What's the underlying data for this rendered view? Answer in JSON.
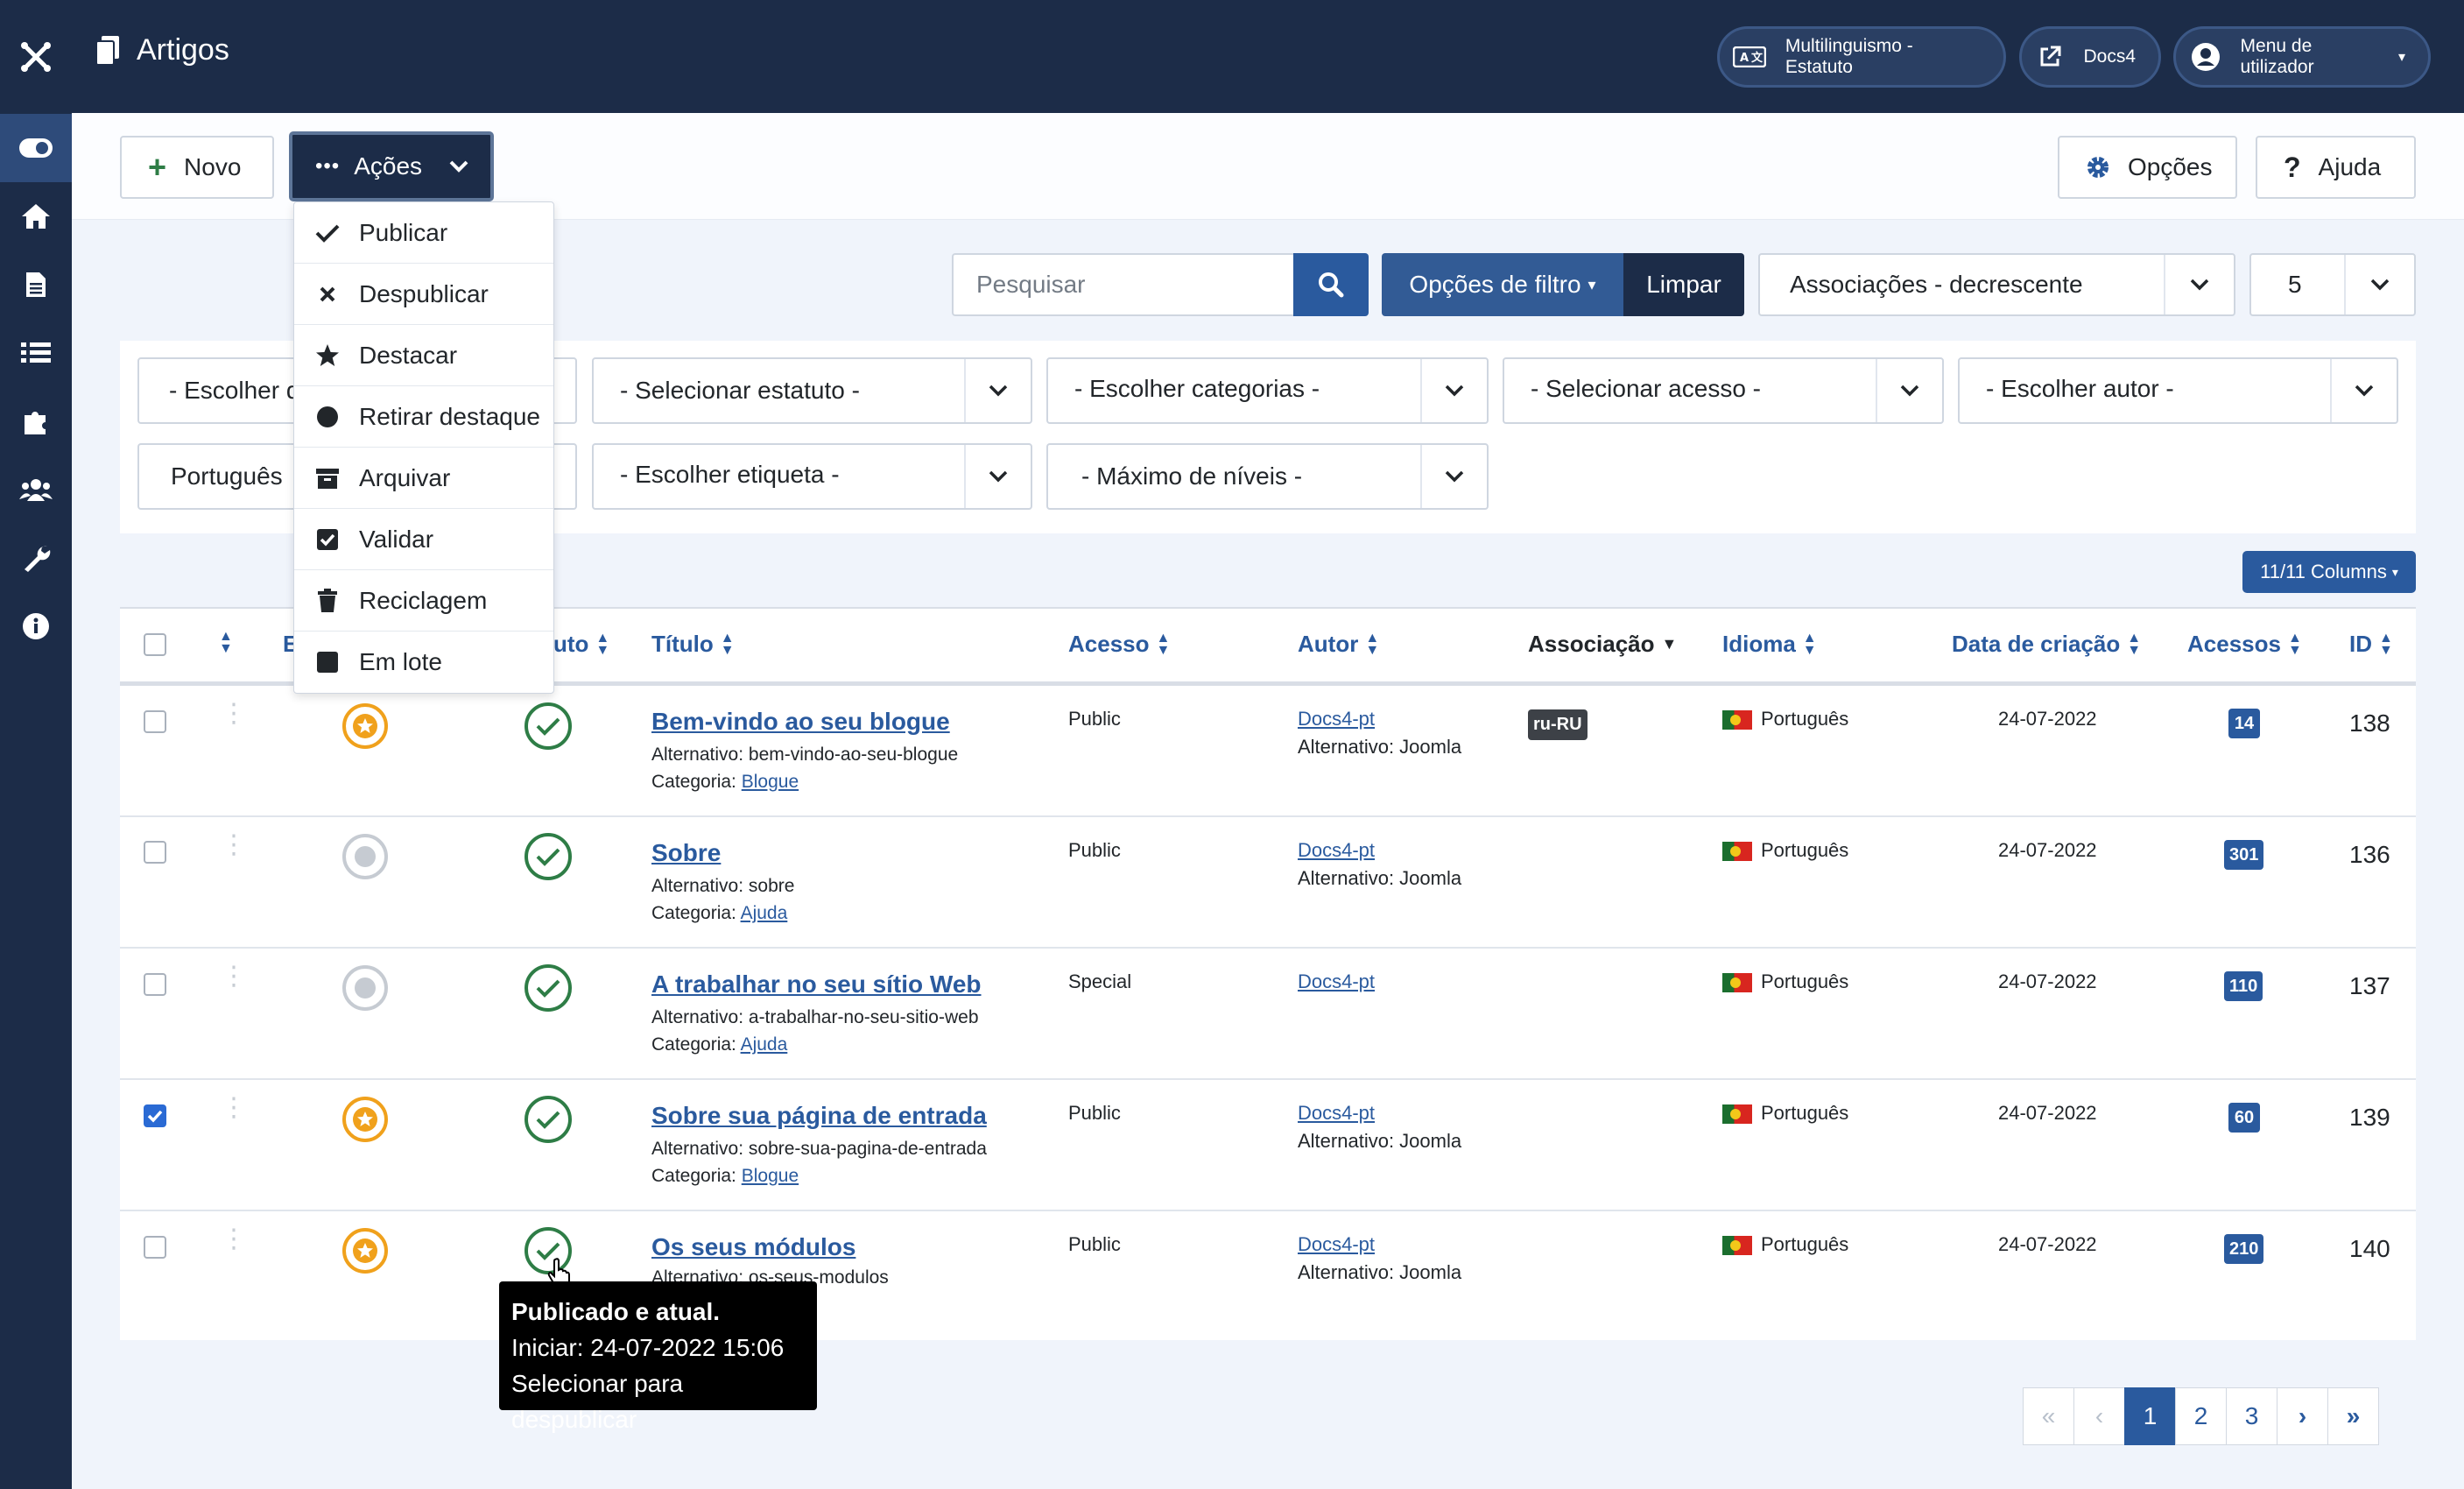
{
  "header": {
    "title": "Artigos",
    "buttons": [
      {
        "label": "Multilinguismo - Estatuto",
        "icon": "language-icon"
      },
      {
        "label": "Docs4",
        "icon": "external-link-icon"
      },
      {
        "label": "Menu de utilizador",
        "icon": "user-icon"
      }
    ]
  },
  "sidebar": {
    "items": [
      "toggle-icon",
      "home-icon",
      "article-icon",
      "list-icon",
      "puzzle-icon",
      "users-icon",
      "wrench-icon",
      "info-icon"
    ]
  },
  "toolbar": {
    "new_label": "Novo",
    "actions_label": "Ações",
    "options_label": "Opções",
    "help_label": "Ajuda"
  },
  "actions_menu": {
    "items": [
      {
        "label": "Publicar",
        "icon": "check-icon"
      },
      {
        "label": "Despublicar",
        "icon": "x-icon"
      },
      {
        "label": "Destacar",
        "icon": "star-icon"
      },
      {
        "label": "Retirar destaque",
        "icon": "circle-icon"
      },
      {
        "label": "Arquivar",
        "icon": "archive-icon"
      },
      {
        "label": "Validar",
        "icon": "checkbox-icon"
      },
      {
        "label": "Reciclagem",
        "icon": "trash-icon"
      },
      {
        "label": "Em lote",
        "icon": "square-icon"
      }
    ]
  },
  "search": {
    "placeholder": "Pesquisar",
    "filter_options_label": "Opções de filtro",
    "clear_label": "Limpar",
    "ordering": "Associações - decrescente",
    "limit": "5"
  },
  "filters": {
    "choose_site": "- Escolher d",
    "status": "- Selecionar estatuto -",
    "categories": "- Escolher categorias -",
    "access": "- Selecionar acesso -",
    "author": "- Escolher autor -",
    "language": "Português",
    "tag": "- Escolher etiqueta -",
    "levels": "- Máximo de níveis -"
  },
  "columns_label": "11/11 Columns",
  "table": {
    "headers": {
      "featured": "E",
      "status": "uto",
      "title": "Título",
      "access": "Acesso",
      "author": "Autor",
      "association": "Associação",
      "language": "Idioma",
      "date": "Data de criação",
      "hits": "Acessos",
      "id": "ID"
    },
    "rows": [
      {
        "checked": false,
        "featured": true,
        "title": "Bem-vindo ao seu blogue",
        "alias": "Alternativo: bem-vindo-ao-seu-blogue",
        "category_prefix": "Categoria:",
        "category": "Blogue",
        "access": "Public",
        "author": "Docs4-pt",
        "author_alias": "Alternativo: Joomla",
        "association": "ru-RU",
        "language": "Português",
        "date": "24-07-2022",
        "hits": "14",
        "id": "138"
      },
      {
        "checked": false,
        "featured": false,
        "title": "Sobre",
        "alias": "Alternativo: sobre",
        "category_prefix": "Categoria:",
        "category": "Ajuda",
        "access": "Public",
        "author": "Docs4-pt",
        "author_alias": "Alternativo: Joomla",
        "association": "",
        "language": "Português",
        "date": "24-07-2022",
        "hits": "301",
        "id": "136"
      },
      {
        "checked": false,
        "featured": false,
        "title": "A trabalhar no seu sítio Web",
        "alias": "Alternativo: a-trabalhar-no-seu-sitio-web",
        "category_prefix": "Categoria:",
        "category": "Ajuda",
        "access": "Special",
        "author": "Docs4-pt",
        "author_alias": "",
        "association": "",
        "language": "Português",
        "date": "24-07-2022",
        "hits": "110",
        "id": "137"
      },
      {
        "checked": true,
        "featured": true,
        "title": "Sobre sua página de entrada",
        "alias": "Alternativo: sobre-sua-pagina-de-entrada",
        "category_prefix": "Categoria:",
        "category": "Blogue",
        "access": "Public",
        "author": "Docs4-pt",
        "author_alias": "Alternativo: Joomla",
        "association": "",
        "language": "Português",
        "date": "24-07-2022",
        "hits": "60",
        "id": "139"
      },
      {
        "checked": false,
        "featured": true,
        "title": "Os seus módulos",
        "alias": "Alternativo: os-seus-modulos",
        "category_prefix": "",
        "category": "",
        "access": "Public",
        "author": "Docs4-pt",
        "author_alias": "Alternativo: Joomla",
        "association": "",
        "language": "Português",
        "date": "24-07-2022",
        "hits": "210",
        "id": "140"
      }
    ]
  },
  "tooltip": {
    "line1": "Publicado e atual.",
    "line2": "Iniciar: 24-07-2022 15:06",
    "line3": "Selecionar para despublicar"
  },
  "pagination": {
    "pages": [
      "1",
      "2",
      "3"
    ],
    "current": "1"
  },
  "colors": {
    "header": "#1c2c48",
    "accent": "#2a5a9e",
    "featured": "#f0a11c",
    "published": "#2e7d46"
  }
}
